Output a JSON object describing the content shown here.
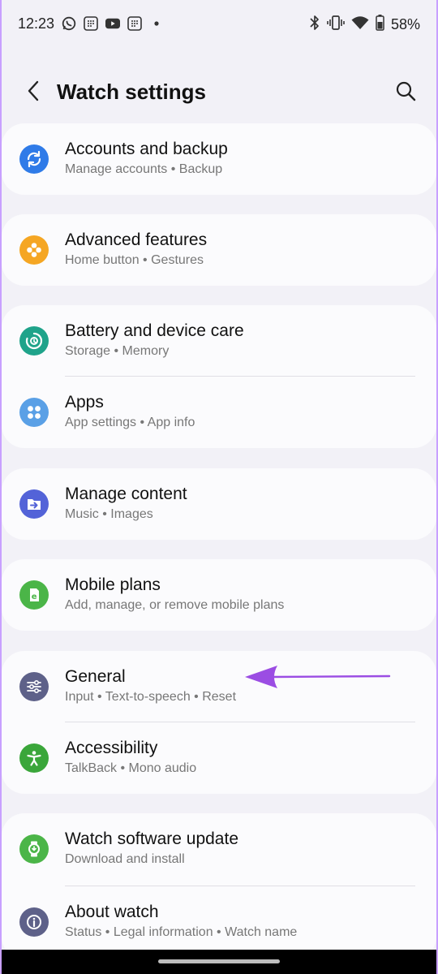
{
  "status": {
    "time": "12:23",
    "battery": "58%",
    "left_icons": [
      "whatsapp-icon",
      "grid-app-icon",
      "youtube-icon",
      "grid-app-icon",
      "dot-icon"
    ],
    "right_icons": [
      "bluetooth-icon",
      "vibrate-icon",
      "wifi-icon",
      "battery-icon"
    ]
  },
  "header": {
    "title": "Watch settings"
  },
  "menu": [
    {
      "title": "Accounts and backup",
      "subtitle": "Manage accounts • Backup",
      "icon": "sync-icon",
      "color": "#2f7be8"
    },
    {
      "title": "Advanced features",
      "subtitle": "Home button • Gestures",
      "icon": "flower-gear-icon",
      "color": "#f5a623"
    },
    {
      "title": "Battery and device care",
      "subtitle": "Storage • Memory",
      "icon": "device-care-icon",
      "color": "#1fa38a"
    },
    {
      "title": "Apps",
      "subtitle": "App settings • App info",
      "icon": "apps-grid-icon",
      "color": "#5aa0e6"
    },
    {
      "title": "Manage content",
      "subtitle": "Music • Images",
      "icon": "folder-arrow-icon",
      "color": "#5363d8"
    },
    {
      "title": "Mobile plans",
      "subtitle": "Add, manage, or remove mobile plans",
      "icon": "esim-icon",
      "color": "#4bb548"
    },
    {
      "title": "General",
      "subtitle": "Input • Text-to-speech • Reset",
      "icon": "sliders-icon",
      "color": "#5e6189"
    },
    {
      "title": "Accessibility",
      "subtitle": "TalkBack • Mono audio",
      "icon": "accessibility-icon",
      "color": "#3aa63a"
    },
    {
      "title": "Watch software update",
      "subtitle": "Download and install",
      "icon": "watch-update-icon",
      "color": "#4bb548"
    },
    {
      "title": "About watch",
      "subtitle": "Status • Legal information • Watch name",
      "icon": "info-icon",
      "color": "#5e6189"
    }
  ],
  "annotation": {
    "arrow_color": "#9b4de3"
  }
}
